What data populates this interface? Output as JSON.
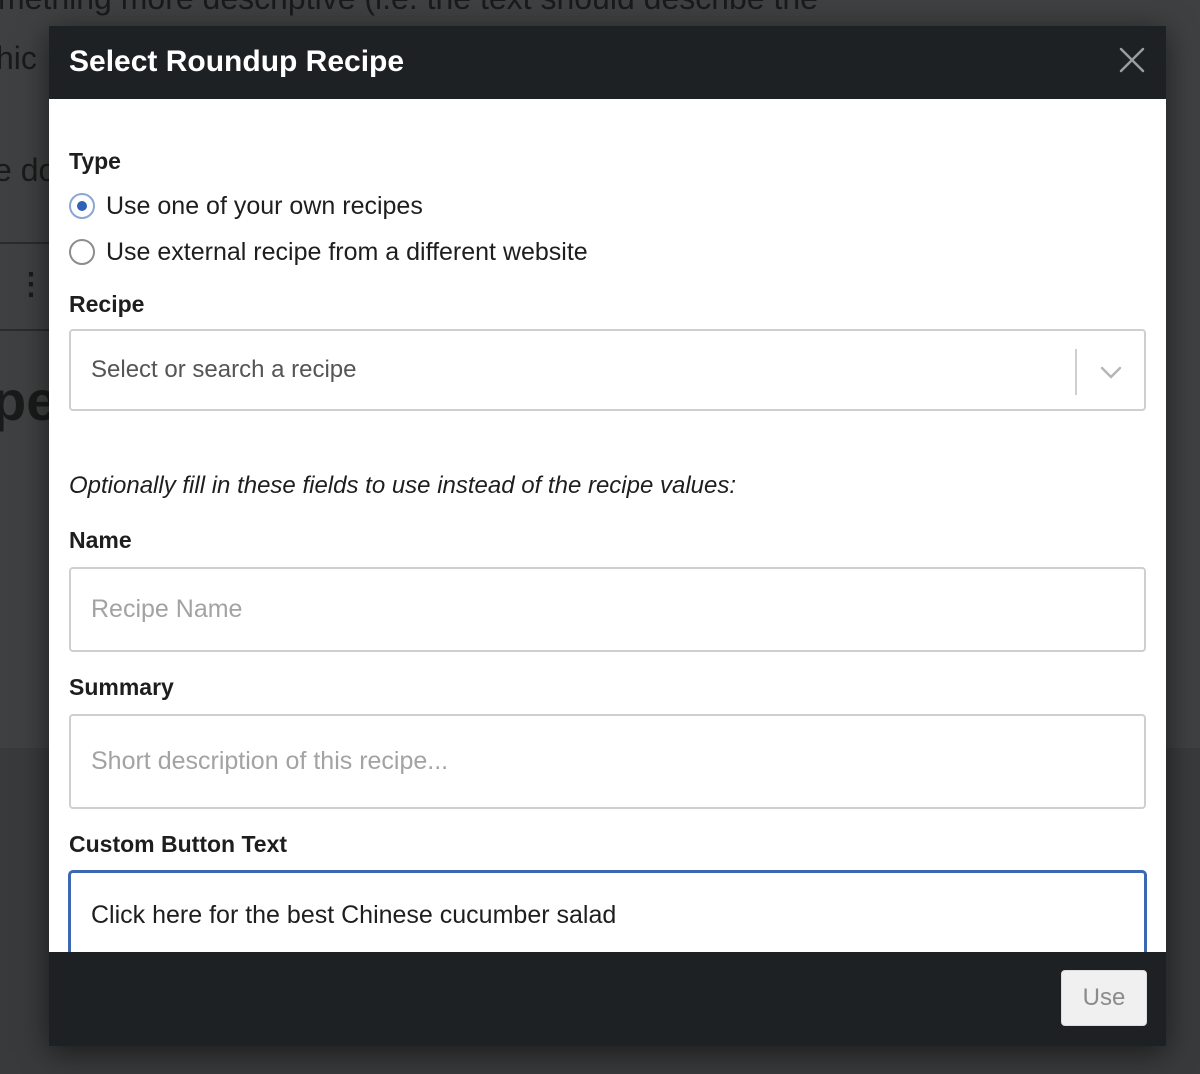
{
  "background": {
    "line1": "mething more descriptive (i.e. the text should describe the",
    "line2": "hic",
    "line3": "e do",
    "heading": "pe",
    "kebab": "⋮"
  },
  "modal": {
    "title": "Select Roundup Recipe",
    "close_icon": "close-icon"
  },
  "type_field": {
    "label": "Type",
    "options": [
      {
        "label": "Use one of your own recipes",
        "checked": true
      },
      {
        "label": "Use external recipe from a different website",
        "checked": false
      }
    ]
  },
  "recipe_field": {
    "label": "Recipe",
    "placeholder": "Select or search a recipe",
    "icon": "chevron-down-icon"
  },
  "hint": "Optionally fill in these fields to use instead of the recipe values:",
  "name_field": {
    "label": "Name",
    "placeholder": "Recipe Name",
    "value": ""
  },
  "summary_field": {
    "label": "Summary",
    "placeholder": "Short description of this recipe...",
    "value": ""
  },
  "button_text_field": {
    "label": "Custom Button Text",
    "value": "Click here for the best Chinese cucumber salad"
  },
  "footer": {
    "use_label": "Use"
  },
  "colors": {
    "header_bg": "#1e2124",
    "radio_accent": "#2e63b8",
    "focus_border": "#3c67b1"
  }
}
